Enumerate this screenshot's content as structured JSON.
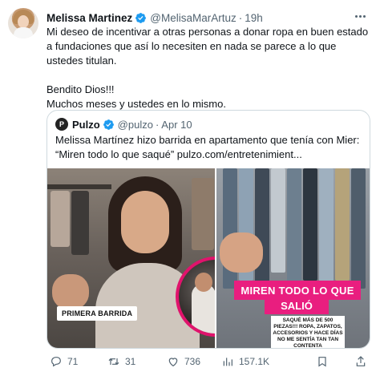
{
  "tweet": {
    "author_name": "Melissa Martinez",
    "handle": "@MelisaMarArtuz",
    "separator": "·",
    "time": "19h",
    "text_line1": "Mi deseo de incentivar a otras personas a donar ropa en buen estado a fundaciones  que así lo necesiten en nada se parece a lo que ustedes titulan.",
    "text_line2": "Bendito Dios!!!",
    "text_line3": "Muchos meses y ustedes en lo mismo."
  },
  "quote": {
    "logo_text": "P",
    "author_name": "Pulzo",
    "handle": "@pulzo",
    "separator": "·",
    "time": "Apr 10",
    "text": "Melissa Martínez hizo barrida en apartamento que tenía con Mier: “Miren todo lo que saqué” pulzo.com/entretenimient...",
    "media": {
      "left_label": "PRIMERA BARRIDA",
      "banner_line1": "MIREN TODO LO QUE",
      "banner_line2": "SALIÓ",
      "caption": "SAQUÉ MÁS DE 500 PIEZAS!!! ROPA, ZAPATOS, ACCESORIOS Y HACE DÍAS NO ME SENTÍA TAN TAN CONTENTA"
    }
  },
  "actions": {
    "replies": "71",
    "retweets": "31",
    "likes": "736",
    "views": "157.1K"
  },
  "colors": {
    "verified": "#1d9bf0",
    "text_primary": "#0f1419",
    "text_secondary": "#536471",
    "banner_pink": "#e91e7f",
    "border": "#cfd9de"
  },
  "icons": [
    "verified-badge-icon",
    "more-icon",
    "reply-icon",
    "retweet-icon",
    "like-icon",
    "views-icon",
    "bookmark-icon",
    "share-icon"
  ]
}
